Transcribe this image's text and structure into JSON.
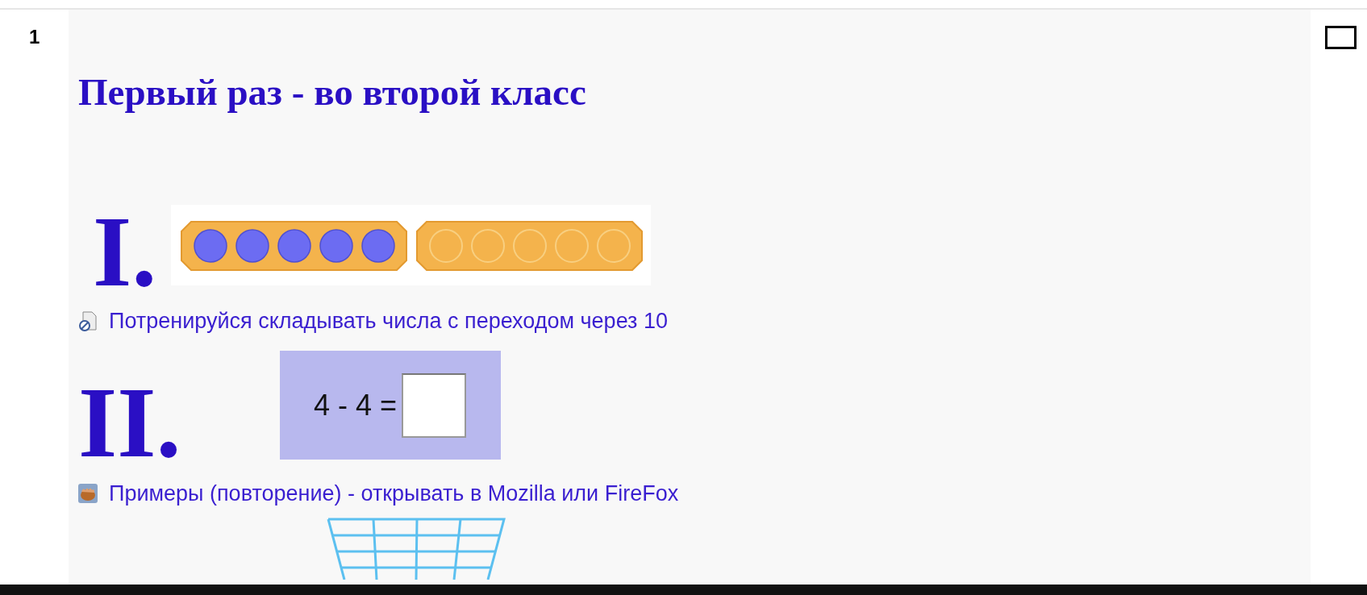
{
  "section_number": "1",
  "checkbox": {
    "checked": false
  },
  "title": "Первый раз - во второй класс",
  "blocks": [
    {
      "kind": "beads",
      "numeral": "I."
    },
    {
      "kind": "document_link",
      "text": "Потренируйся складывать числа с переходом через 10"
    },
    {
      "kind": "equation",
      "numeral": "II.",
      "expression": "4 - 4 ="
    },
    {
      "kind": "hand_link",
      "text": "Примеры (повторение) - открывать в Mozilla или FireFox"
    },
    {
      "kind": "basket"
    }
  ]
}
